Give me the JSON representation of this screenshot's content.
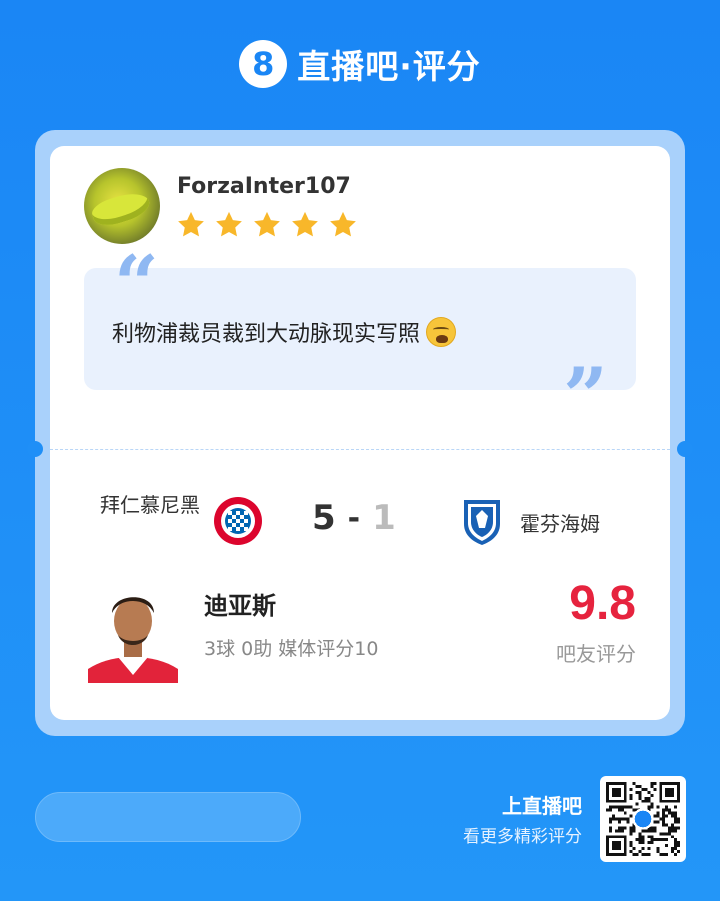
{
  "brand": {
    "logo_glyph": "8",
    "title": "直播吧·评分"
  },
  "review": {
    "username": "ForzaInter107",
    "rating_stars": 5,
    "comment": "利物浦裁员裁到大动脉现实写照",
    "emoji": "weary-face-icon"
  },
  "match": {
    "home_team": "拜仁慕尼黑",
    "home_score": "5",
    "separator": "-",
    "away_score": "1",
    "away_team": "霍芬海姆"
  },
  "player": {
    "name": "迪亚斯",
    "stats": "3球 0助 媒体评分10",
    "fan_score": "9.8",
    "fan_score_label": "吧友评分"
  },
  "footer": {
    "cta_title": "上直播吧",
    "cta_subtitle": "看更多精彩评分"
  },
  "colors": {
    "background": "#1f8ff7",
    "star": "#f8b72a",
    "score_red": "#e6233e",
    "quote_mark": "#8fb8f2"
  }
}
